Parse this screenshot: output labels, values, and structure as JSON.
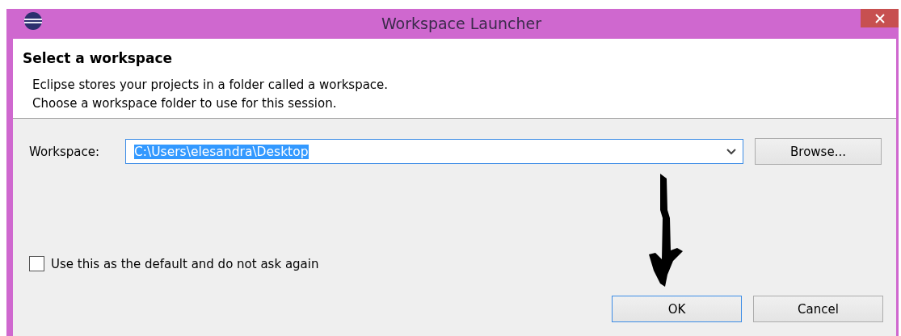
{
  "window": {
    "title": "Workspace Launcher"
  },
  "header": {
    "title": "Select a workspace",
    "description": [
      "Eclipse stores your projects in a folder called a workspace.",
      "Choose a workspace folder to use for this session."
    ]
  },
  "workspace": {
    "label": "Workspace:",
    "value": "C:\\Users\\elesandra\\Desktop",
    "text_selected": true,
    "browse_button": "Browse..."
  },
  "checkbox": {
    "label": "Use this as the default and do not ask again",
    "checked": false
  },
  "buttons": [
    {
      "label": "OK",
      "default": true
    },
    {
      "label": "Cancel",
      "default": false
    }
  ]
}
